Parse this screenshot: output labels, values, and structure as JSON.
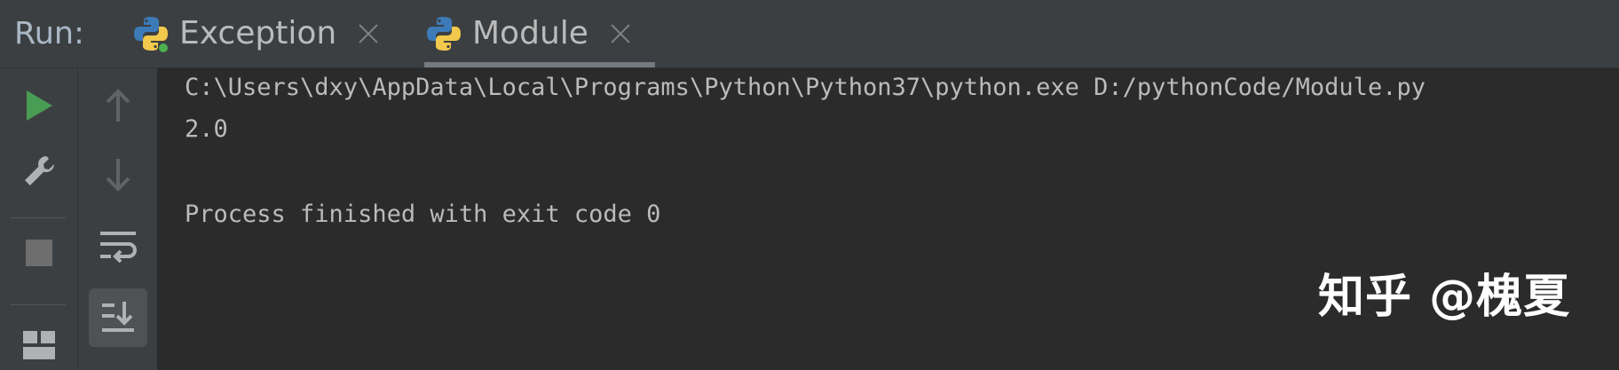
{
  "header": {
    "run_label": "Run:",
    "tabs": [
      {
        "label": "Exception",
        "icon": "python-icon",
        "active": false
      },
      {
        "label": "Module",
        "icon": "python-icon",
        "active": true
      }
    ]
  },
  "toolbar_primary": [
    {
      "icon": "rerun-icon",
      "color": "#499c54"
    },
    {
      "icon": "wrench-icon"
    },
    {
      "icon": "stop-icon"
    },
    {
      "icon": "layout-icon"
    }
  ],
  "toolbar_secondary": [
    {
      "icon": "up-arrow-icon"
    },
    {
      "icon": "down-arrow-icon"
    },
    {
      "icon": "soft-wrap-icon"
    },
    {
      "icon": "scroll-to-end-icon",
      "selected": true
    }
  ],
  "console": {
    "lines": [
      "C:\\Users\\dxy\\AppData\\Local\\Programs\\Python\\Python37\\python.exe D:/pythonCode/Module.py",
      "2.0",
      "",
      "Process finished with exit code 0"
    ]
  },
  "watermark": "知乎 @槐夏",
  "colors": {
    "background": "#2b2b2b",
    "panel": "#3c3f41",
    "text": "#bbbbbb",
    "run_green": "#499c54"
  }
}
